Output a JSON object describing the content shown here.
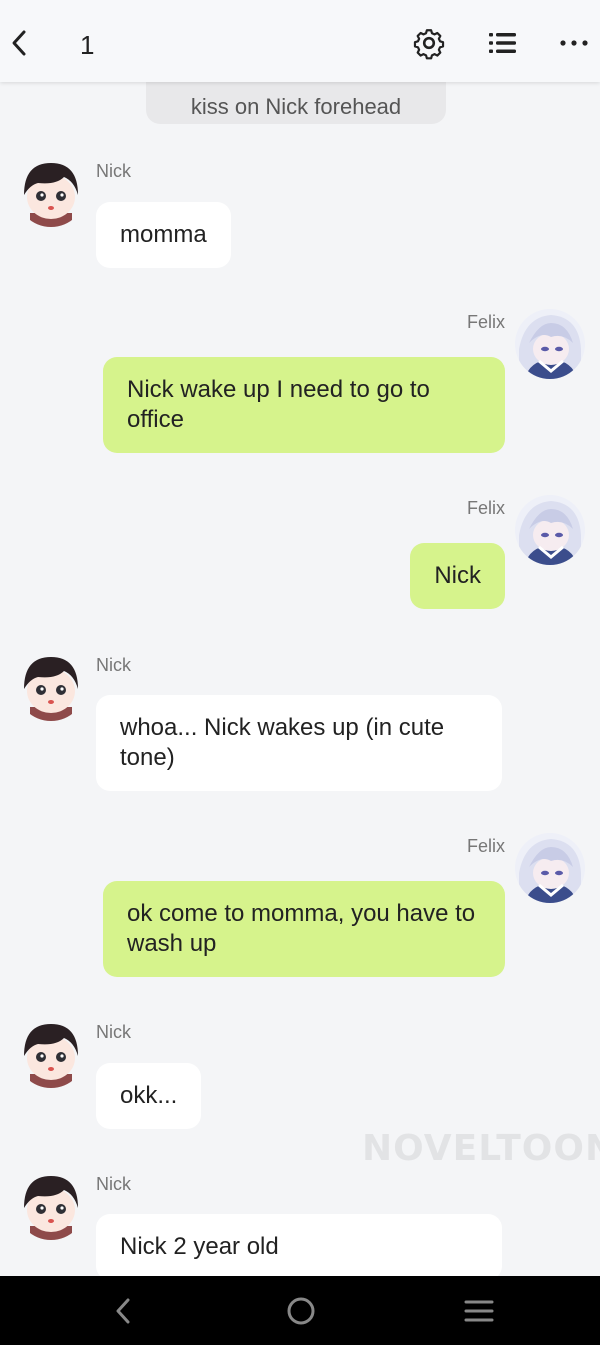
{
  "header": {
    "title": "1"
  },
  "narration": {
    "text": "kiss on Nick forehead"
  },
  "messages": [
    {
      "side": "left",
      "name": "Nick",
      "text": "momma"
    },
    {
      "side": "right",
      "name": "Felix",
      "text": "Nick wake up I need to go to office"
    },
    {
      "side": "right",
      "name": "Felix",
      "text": "Nick"
    },
    {
      "side": "left",
      "name": "Nick",
      "text": "whoa... Nick wakes up (in cute tone)"
    },
    {
      "side": "right",
      "name": "Felix",
      "text": "ok come to momma, you have to wash up"
    },
    {
      "side": "left",
      "name": "Nick",
      "text": "okk..."
    },
    {
      "side": "left",
      "name": "Nick",
      "text": "Nick 2 year old"
    }
  ],
  "watermark": "NOVELTOON",
  "icons": {
    "back": "chevron-left-icon",
    "settings": "gear-icon",
    "list": "list-icon",
    "more": "more-dots-icon",
    "nav_back": "nav-back-icon",
    "nav_home": "nav-home-icon",
    "nav_menu": "nav-menu-icon"
  },
  "colors": {
    "right_bubble": "#d6f38c",
    "left_bubble": "#ffffff",
    "background": "#f4f5f7"
  }
}
